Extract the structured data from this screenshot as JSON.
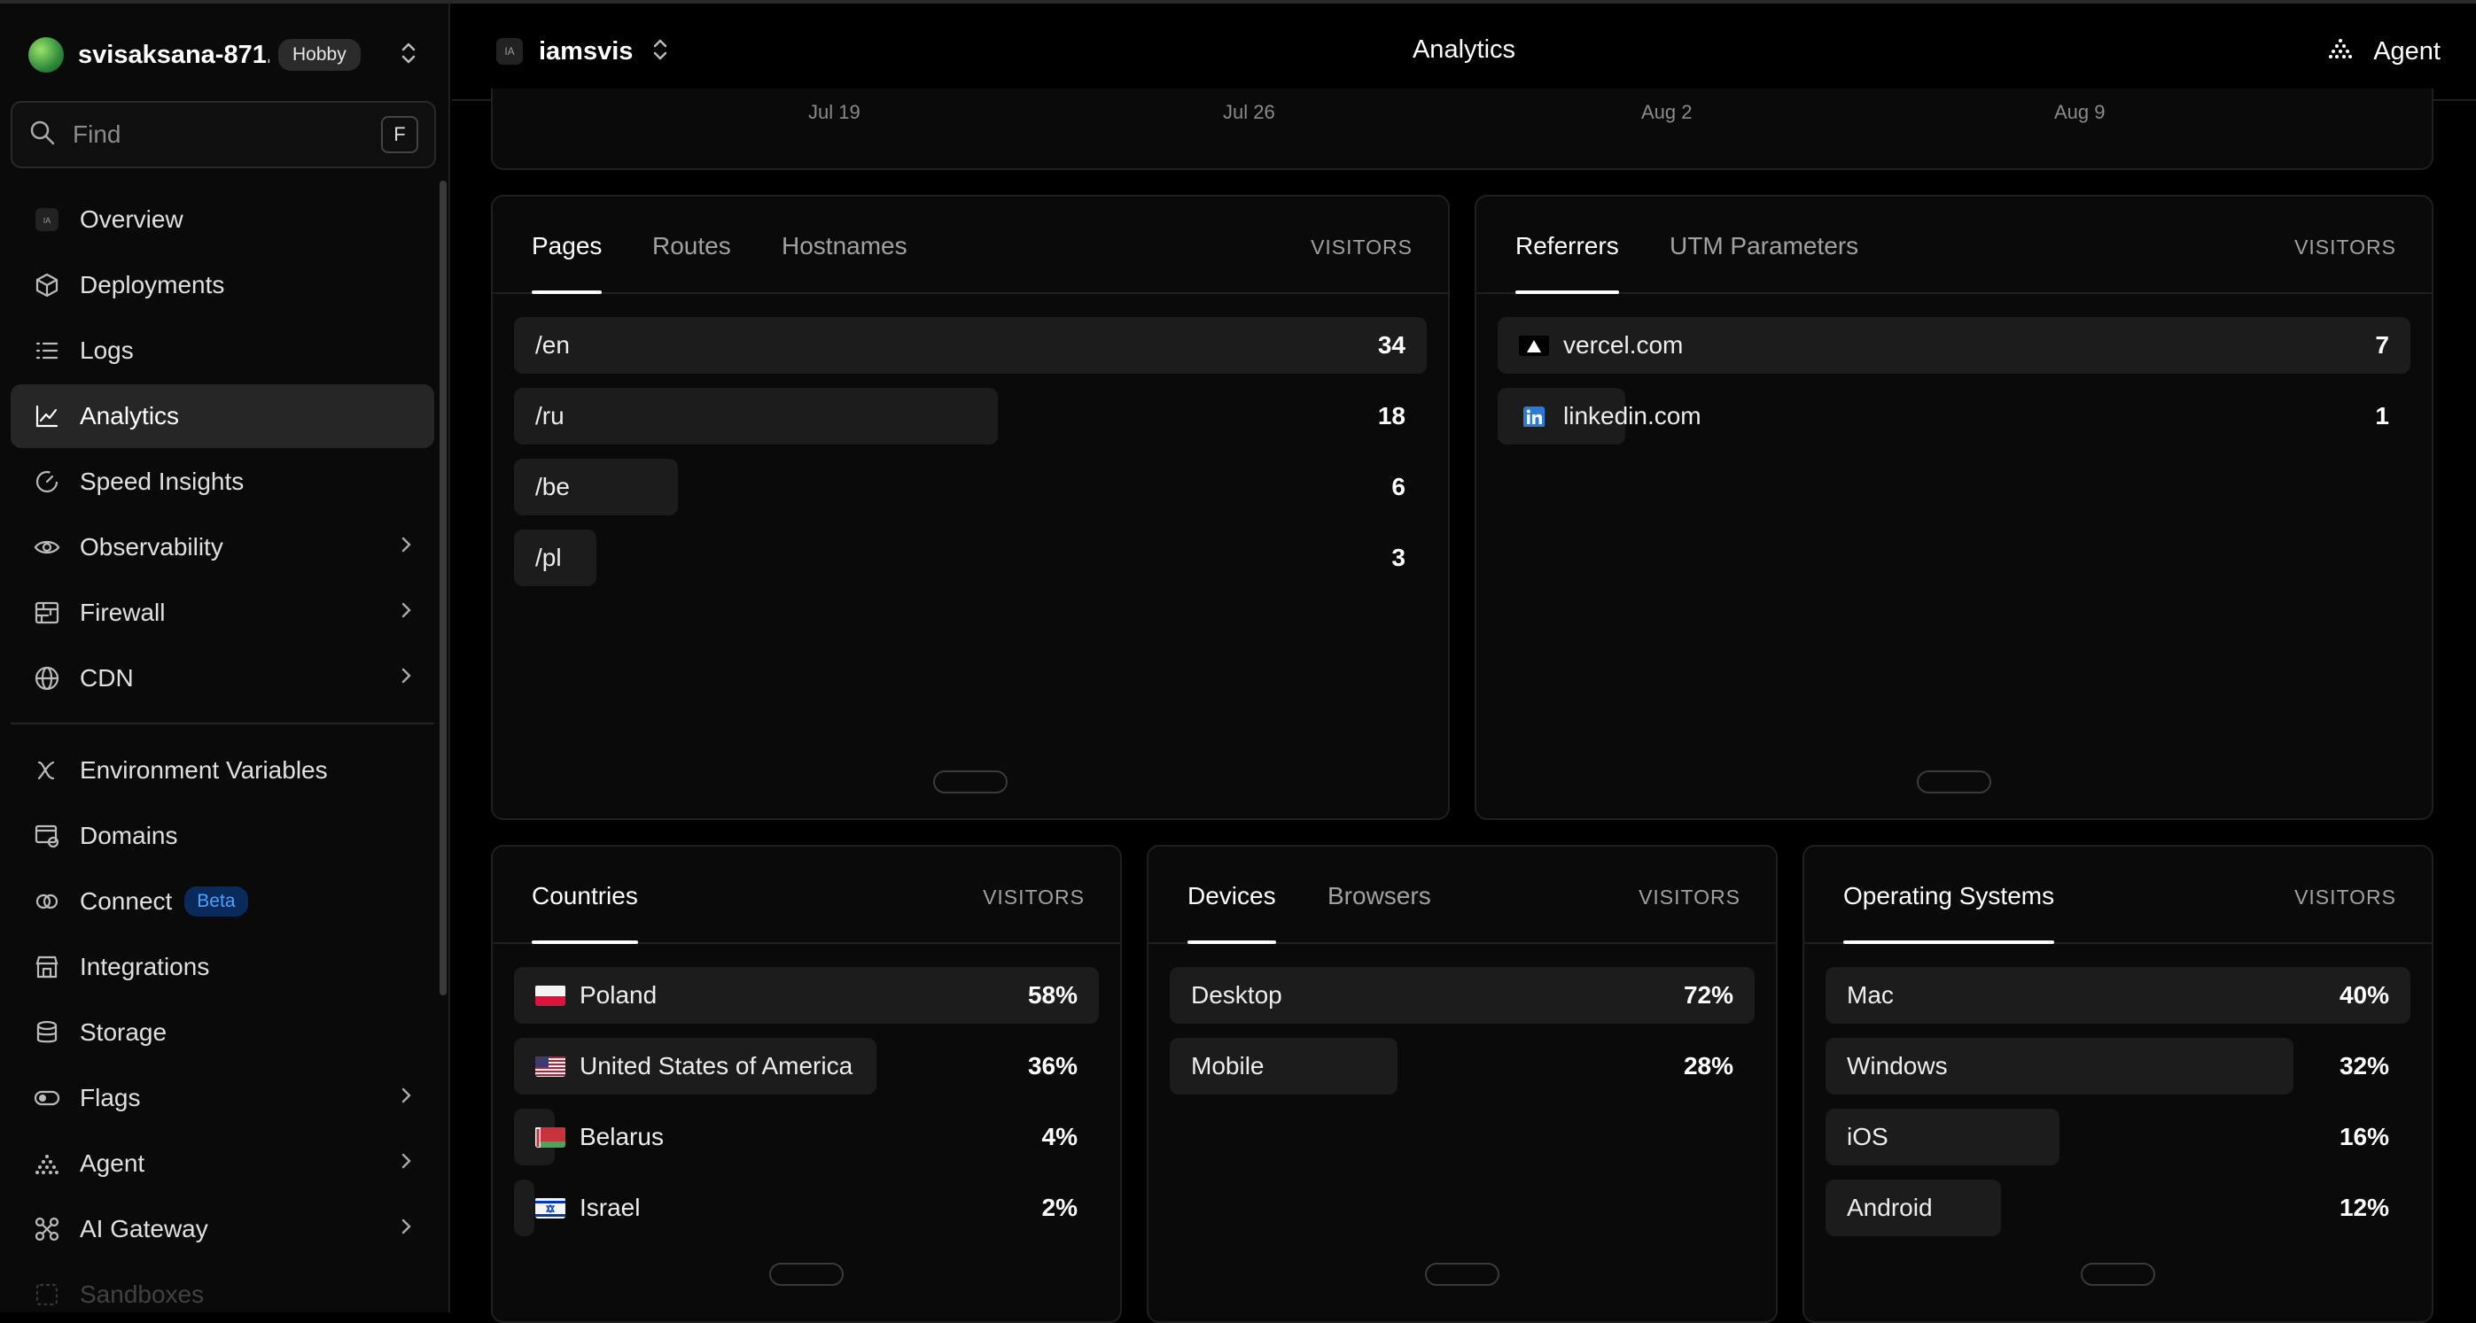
{
  "sidebar": {
    "team_name": "svisaksana-871...",
    "plan_badge": "Hobby",
    "find_placeholder": "Find",
    "find_shortcut": "F",
    "items": [
      {
        "label": "Overview"
      },
      {
        "label": "Deployments"
      },
      {
        "label": "Logs"
      },
      {
        "label": "Analytics"
      },
      {
        "label": "Speed Insights"
      },
      {
        "label": "Observability"
      },
      {
        "label": "Firewall"
      },
      {
        "label": "CDN"
      },
      {
        "label": "Environment Variables"
      },
      {
        "label": "Domains"
      },
      {
        "label": "Connect",
        "badge": "Beta"
      },
      {
        "label": "Integrations"
      },
      {
        "label": "Storage"
      },
      {
        "label": "Flags"
      },
      {
        "label": "Agent"
      },
      {
        "label": "AI Gateway"
      },
      {
        "label": "Sandboxes"
      }
    ]
  },
  "header": {
    "project_initials": "IA",
    "project_name": "iamsvis",
    "title": "Analytics",
    "agent_label": "Agent"
  },
  "chart_axis": {
    "ticks": [
      "Jul 19",
      "Jul 26",
      "Aug 2",
      "Aug 9"
    ]
  },
  "pages_card": {
    "tabs": [
      "Pages",
      "Routes",
      "Hostnames"
    ],
    "visitors_label": "VISITORS",
    "rows": [
      {
        "label": "/en",
        "value": "34",
        "fraction": 1.0
      },
      {
        "label": "/ru",
        "value": "18",
        "fraction": 0.53
      },
      {
        "label": "/be",
        "value": "6",
        "fraction": 0.18
      },
      {
        "label": "/pl",
        "value": "3",
        "fraction": 0.09
      }
    ]
  },
  "referrers_card": {
    "tabs": [
      "Referrers",
      "UTM Parameters"
    ],
    "visitors_label": "VISITORS",
    "rows": [
      {
        "label": "vercel.com",
        "value": "7",
        "icon": "vercel-icon",
        "fraction": 1.0
      },
      {
        "label": "linkedin.com",
        "value": "1",
        "icon": "linkedin-icon",
        "fraction": 0.14
      }
    ]
  },
  "countries_card": {
    "tabs": [
      "Countries"
    ],
    "visitors_label": "VISITORS",
    "rows": [
      {
        "label": "Poland",
        "value": "58%",
        "flag": "poland-flag-icon",
        "fraction": 1.0
      },
      {
        "label": "United States of America",
        "value": "36%",
        "flag": "usa-flag-icon",
        "fraction": 0.62
      },
      {
        "label": "Belarus",
        "value": "4%",
        "flag": "belarus-flag-icon",
        "fraction": 0.07
      },
      {
        "label": "Israel",
        "value": "2%",
        "flag": "israel-flag-icon",
        "fraction": 0.035
      }
    ]
  },
  "devices_card": {
    "tabs": [
      "Devices",
      "Browsers"
    ],
    "visitors_label": "VISITORS",
    "rows": [
      {
        "label": "Desktop",
        "value": "72%",
        "fraction": 1.0
      },
      {
        "label": "Mobile",
        "value": "28%",
        "fraction": 0.39
      }
    ]
  },
  "os_card": {
    "tabs": [
      "Operating Systems"
    ],
    "visitors_label": "VISITORS",
    "rows": [
      {
        "label": "Mac",
        "value": "40%",
        "fraction": 1.0
      },
      {
        "label": "Windows",
        "value": "32%",
        "fraction": 0.8
      },
      {
        "label": "iOS",
        "value": "16%",
        "fraction": 0.4
      },
      {
        "label": "Android",
        "value": "12%",
        "fraction": 0.3
      }
    ]
  },
  "colors": {
    "background": "#000000",
    "panel": "#0a0a0a",
    "bar": "#1c1c1c",
    "beta_text": "#4ca3ff"
  }
}
